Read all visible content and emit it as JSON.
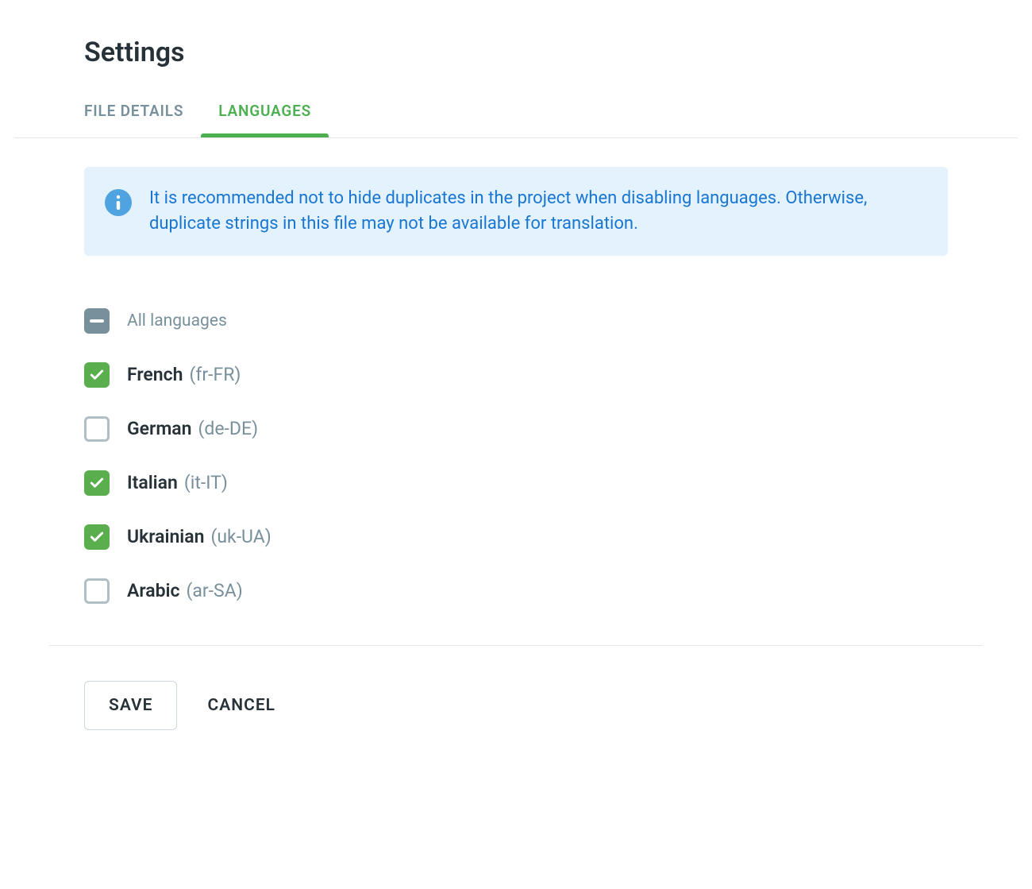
{
  "header": {
    "title": "Settings"
  },
  "tabs": [
    {
      "label": "FILE DETAILS",
      "active": false
    },
    {
      "label": "LANGUAGES",
      "active": true
    }
  ],
  "banner": {
    "text": "It is recommended not to hide duplicates in the project when disabling languages. Otherwise, duplicate strings in this file may not be available for translation."
  },
  "all_languages": {
    "label": "All languages",
    "state": "indeterminate"
  },
  "languages": [
    {
      "name": "French",
      "code": "(fr-FR)",
      "checked": true
    },
    {
      "name": "German",
      "code": "(de-DE)",
      "checked": false
    },
    {
      "name": "Italian",
      "code": "(it-IT)",
      "checked": true
    },
    {
      "name": "Ukrainian",
      "code": "(uk-UA)",
      "checked": true
    },
    {
      "name": "Arabic",
      "code": "(ar-SA)",
      "checked": false
    }
  ],
  "footer": {
    "save_label": "SAVE",
    "cancel_label": "CANCEL"
  }
}
